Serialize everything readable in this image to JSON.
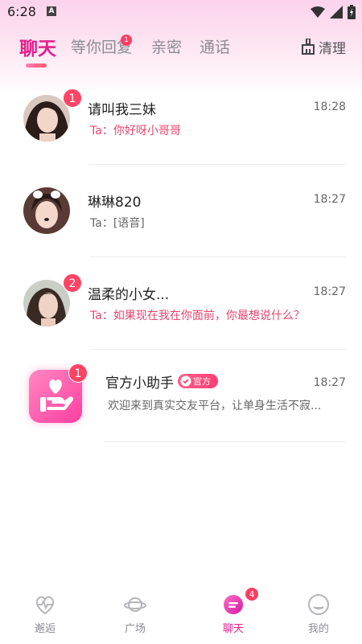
{
  "status_bar": {
    "time": "6:28",
    "notif_letter": "A"
  },
  "tabs": [
    {
      "label": "聊天",
      "active": true
    },
    {
      "label": "等你回复",
      "active": false,
      "badge": "1"
    },
    {
      "label": "亲密",
      "active": false
    },
    {
      "label": "通话",
      "active": false
    }
  ],
  "clean_button": {
    "label": "清理",
    "icon": "broom-icon"
  },
  "chats": [
    {
      "name": "请叫我三妹",
      "time": "18:28",
      "preview": "Ta：你好呀小哥哥",
      "unread": "1"
    },
    {
      "name": "琳琳820",
      "time": "18:27",
      "preview": "Ta：[语音]",
      "unread": ""
    },
    {
      "name": "温柔的小女...",
      "time": "18:27",
      "preview": "Ta：如果现在我在你面前，你最想说什么？",
      "unread": "2"
    },
    {
      "name": "官方小助手",
      "time": "18:27",
      "preview": "欢迎来到真实交友平台，让单身生活不寂...",
      "unread": "1",
      "tag": "官方"
    }
  ],
  "bottom_nav": [
    {
      "label": "邂逅",
      "icon": "heart-pulse-icon",
      "active": false
    },
    {
      "label": "广场",
      "icon": "planet-icon",
      "active": false
    },
    {
      "label": "聊天",
      "icon": "chat-bubble-icon",
      "active": true,
      "badge": "4"
    },
    {
      "label": "我的",
      "icon": "profile-face-icon",
      "active": false
    }
  ],
  "colors": {
    "accent": "#e61e8c",
    "badge": "#ff4466",
    "preview_highlight": "#e8456e"
  }
}
